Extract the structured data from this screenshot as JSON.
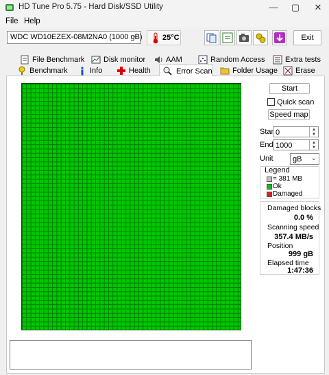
{
  "window": {
    "title": "HD Tune Pro 5.75 - Hard Disk/SSD Utility"
  },
  "menu": [
    "File",
    "Help"
  ],
  "toolbar": {
    "drive": "WDC WD10EZEX-08M2NA0 (1000 gB)",
    "temperature": "25°C",
    "exit_label": "Exit"
  },
  "tabs_row1": [
    "File Benchmark",
    "Disk monitor",
    "AAM",
    "Random Access",
    "Extra tests"
  ],
  "tabs_row2": [
    "Benchmark",
    "Info",
    "Health",
    "Error Scan",
    "Folder Usage",
    "Erase"
  ],
  "side": {
    "start_button": "Start",
    "quick_scan_label": "Quick scan",
    "speed_map_button": "Speed map",
    "start_label": "Start",
    "start_value": "0",
    "end_label": "End",
    "end_value": "1000",
    "unit_label": "Unit",
    "unit_value": "gB",
    "legend_title": "Legend",
    "legend_block": "= 381 MB",
    "legend_ok": "Ok",
    "legend_damaged": "Damaged",
    "damaged_blocks_label": "Damaged blocks",
    "damaged_blocks_value": "0.0 %",
    "scanning_speed_label": "Scanning speed",
    "scanning_speed_value": "357.4 MB/s",
    "position_label": "Position",
    "position_value": "999 gB",
    "elapsed_label": "Elapsed time",
    "elapsed_value": "1:47:36"
  },
  "colors": {
    "ok": "#00c800",
    "damaged": "#e02020",
    "grid_line": "#007a00"
  },
  "icons": {
    "app": "hd-tune-icon",
    "thermometer": "thermometer-icon",
    "toolbar": [
      "copy-info-icon",
      "copy-text-icon",
      "screenshot-icon",
      "options-icon",
      "save-icon"
    ]
  }
}
